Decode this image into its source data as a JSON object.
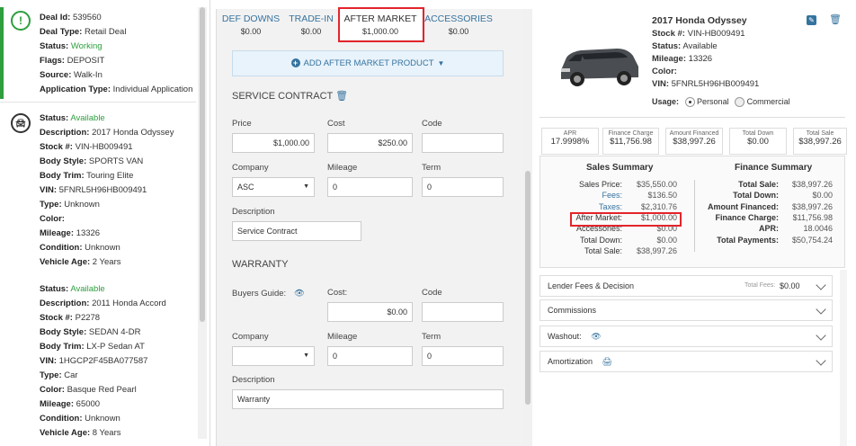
{
  "deal": {
    "deal_id_label": "Deal Id:",
    "deal_id": "539560",
    "deal_type_label": "Deal Type:",
    "deal_type": "Retail Deal",
    "status_label": "Status:",
    "status": "Working",
    "flags_label": "Flags:",
    "flags": "DEPOSIT",
    "source_label": "Source:",
    "source": "Walk-In",
    "app_type_label": "Application Type:",
    "app_type": "Individual Application"
  },
  "vehicles": [
    {
      "status_label": "Status:",
      "status": "Available",
      "description_label": "Description:",
      "description": "2017 Honda Odyssey",
      "stock_label": "Stock #:",
      "stock": "VIN-HB009491",
      "body_style_label": "Body Style:",
      "body_style": "SPORTS VAN",
      "body_trim_label": "Body Trim:",
      "body_trim": "Touring Elite",
      "vin_label": "VIN:",
      "vin": "5FNRL5H96HB009491",
      "type_label": "Type:",
      "type": "Unknown",
      "color_label": "Color:",
      "color": "",
      "mileage_label": "Mileage:",
      "mileage": "13326",
      "condition_label": "Condition:",
      "condition": "Unknown",
      "age_label": "Vehicle Age:",
      "age": "2 Years"
    },
    {
      "status_label": "Status:",
      "status": "Available",
      "description_label": "Description:",
      "description": "2011 Honda Accord",
      "stock_label": "Stock #:",
      "stock": "P2278",
      "body_style_label": "Body Style:",
      "body_style": "SEDAN 4-DR",
      "body_trim_label": "Body Trim:",
      "body_trim": "LX-P Sedan AT",
      "vin_label": "VIN:",
      "vin": "1HGCP2F45BA077587",
      "type_label": "Type:",
      "type": "Car",
      "color_label": "Color:",
      "color": "Basque Red Pearl",
      "mileage_label": "Mileage:",
      "mileage": "65000",
      "condition_label": "Condition:",
      "condition": "Unknown",
      "age_label": "Vehicle Age:",
      "age": "8 Years"
    }
  ],
  "tabs": [
    {
      "label": "DEF DOWNS",
      "amount": "$0.00"
    },
    {
      "label": "TRADE-IN",
      "amount": "$0.00"
    },
    {
      "label": "AFTER MARKET",
      "amount": "$1,000.00"
    },
    {
      "label": "ACCESSORIES",
      "amount": "$0.00"
    }
  ],
  "add_button": "ADD AFTER MARKET PRODUCT",
  "service": {
    "title": "SERVICE CONTRACT",
    "price_label": "Price",
    "price": "$1,000.00",
    "cost_label": "Cost",
    "cost": "$250.00",
    "code_label": "Code",
    "code": "",
    "company_label": "Company",
    "company": "ASC",
    "mileage_label": "Mileage",
    "mileage": "0",
    "term_label": "Term",
    "term": "0",
    "description_label": "Description",
    "description": "Service Contract"
  },
  "warranty": {
    "title": "WARRANTY",
    "buyers_label": "Buyers Guide:",
    "cost_label": "Cost:",
    "cost": "$0.00",
    "code_label": "Code",
    "code": "",
    "company_label": "Company",
    "company": "",
    "mileage_label": "Mileage",
    "mileage": "0",
    "term_label": "Term",
    "term": "0",
    "description_label": "Description",
    "description": "Warranty"
  },
  "car": {
    "title": "2017 Honda Odyssey",
    "stock_label": "Stock #:",
    "stock": "VIN-HB009491",
    "status_label": "Status:",
    "status": "Available",
    "mileage_label": "Mileage:",
    "mileage": "13326",
    "color_label": "Color:",
    "color": "",
    "vin_label": "VIN:",
    "vin": "5FNRL5H96HB009491",
    "usage_label": "Usage:",
    "personal": "Personal",
    "commercial": "Commercial"
  },
  "finance_boxes": [
    {
      "label": "APR",
      "value": "17.9998%"
    },
    {
      "label": "Finance Charge",
      "value": "$11,756.98"
    },
    {
      "label": "Amount Financed",
      "value": "$38,997.26"
    },
    {
      "label": "Total Down",
      "value": "$0.00"
    },
    {
      "label": "Total Sale",
      "value": "$38,997.26"
    }
  ],
  "sales_summary": {
    "title": "Sales Summary",
    "rows": [
      {
        "label": "Sales Price:",
        "value": "$35,550.00"
      },
      {
        "label": "Fees:",
        "value": "$136.50"
      },
      {
        "label": "Taxes:",
        "value": "$2,310.76"
      },
      {
        "label": "After Market:",
        "value": "$1,000.00"
      },
      {
        "label": "Accessories:",
        "value": "$0.00"
      },
      {
        "label": "Total Down:",
        "value": "$0.00"
      },
      {
        "label": "Total Sale:",
        "value": "$38,997.26"
      }
    ]
  },
  "finance_summary": {
    "title": "Finance Summary",
    "rows": [
      {
        "label": "Total Sale:",
        "value": "$38,997.26"
      },
      {
        "label": "Total Down:",
        "value": "$0.00"
      },
      {
        "label": "Amount Financed:",
        "value": "$38,997.26"
      },
      {
        "label": "Finance Charge:",
        "value": "$11,756.98"
      },
      {
        "label": "APR:",
        "value": "18.0046"
      },
      {
        "label": "Total Payments:",
        "value": "$50,754.24"
      }
    ]
  },
  "accordions": {
    "lender": "Lender Fees & Decision",
    "total_fees_label": "Total Fees:",
    "total_fees": "$0.00",
    "commissions": "Commissions",
    "washout": "Washout:",
    "amortization": "Amortization"
  },
  "colors": {
    "link": "#35739f",
    "green": "#2e9e3e",
    "highlight": "#e3242b"
  }
}
